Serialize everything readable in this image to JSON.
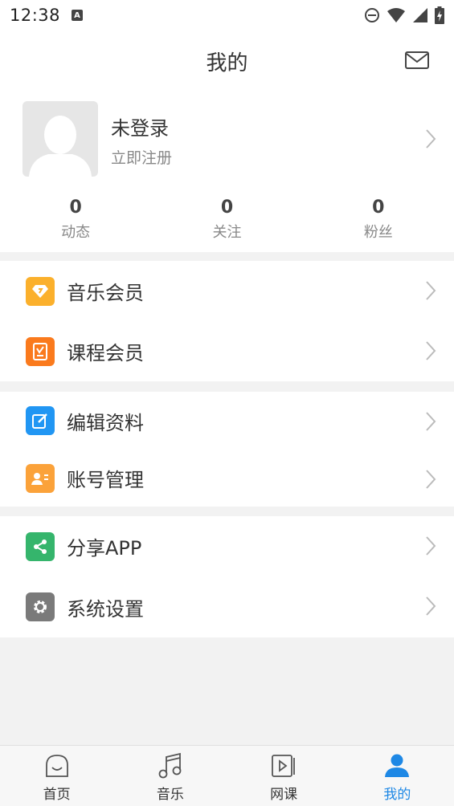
{
  "status_bar": {
    "time": "12:38",
    "notification_letter": "A"
  },
  "header": {
    "title": "我的"
  },
  "profile": {
    "name": "未登录",
    "subtitle": "立即注册"
  },
  "stats": [
    {
      "value": "0",
      "label": "动态"
    },
    {
      "value": "0",
      "label": "关注"
    },
    {
      "value": "0",
      "label": "粉丝"
    }
  ],
  "menu_groups": [
    [
      {
        "label": "音乐会员",
        "icon": "diamond-icon",
        "color": "#fbb02c"
      },
      {
        "label": "课程会员",
        "icon": "course-icon",
        "color": "#fa7a1d"
      }
    ],
    [
      {
        "label": "编辑资料",
        "icon": "edit-icon",
        "color": "#2196f3"
      },
      {
        "label": "账号管理",
        "icon": "account-card-icon",
        "color": "#fba23a"
      }
    ],
    [
      {
        "label": "分享APP",
        "icon": "share-icon",
        "color": "#35b56c"
      },
      {
        "label": "系统设置",
        "icon": "gear-icon",
        "color": "#7a7a7a"
      }
    ]
  ],
  "tabbar": [
    {
      "label": "首页",
      "icon": "home-icon",
      "active": false
    },
    {
      "label": "音乐",
      "icon": "music-note-icon",
      "active": false
    },
    {
      "label": "网课",
      "icon": "video-course-icon",
      "active": false
    },
    {
      "label": "我的",
      "icon": "person-icon",
      "active": true
    }
  ],
  "colors": {
    "accent": "#1e88e5",
    "background": "#f2f2f2"
  }
}
